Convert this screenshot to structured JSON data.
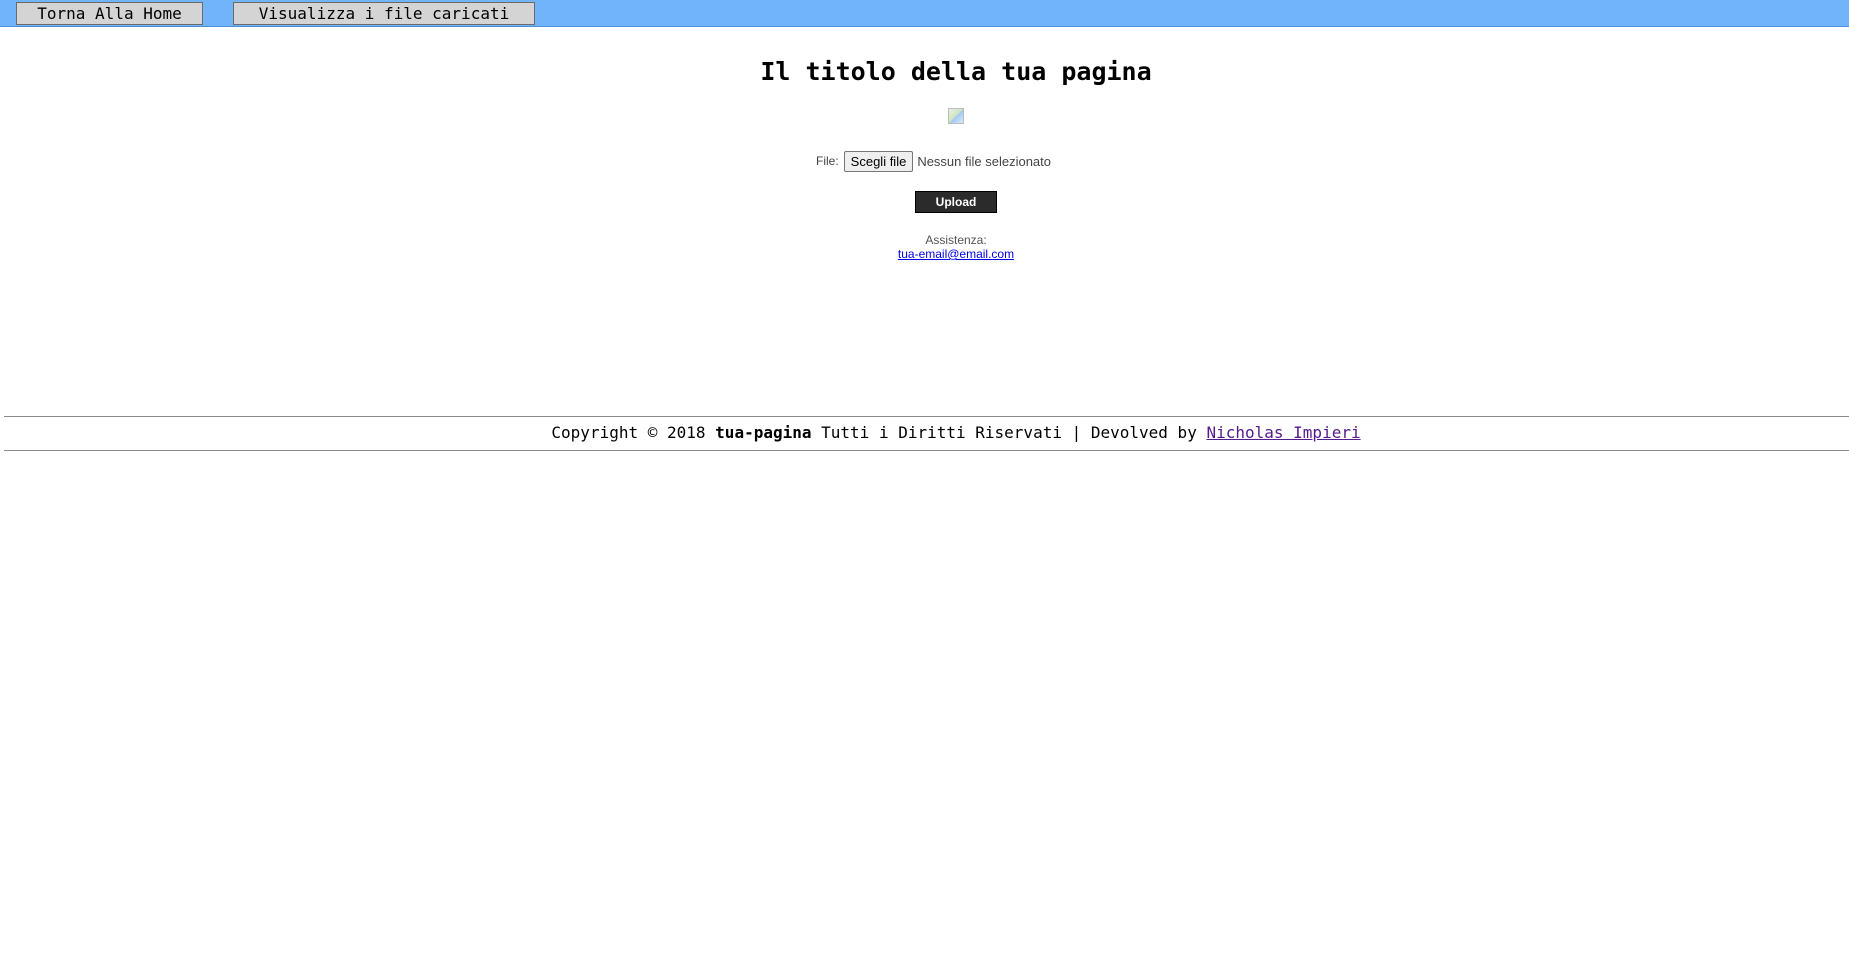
{
  "nav": {
    "home_label": "Torna Alla Home",
    "files_label": "Visualizza i file caricati"
  },
  "main": {
    "title": "Il titolo della tua pagina",
    "file_label": "File:",
    "choose_file_label": "Scegli file",
    "file_status": "Nessun file selezionato",
    "upload_label": "Upload",
    "support_label": "Assistenza:",
    "support_email": "tua-email@email.com"
  },
  "footer": {
    "copyright": "Copyright © 2018",
    "site_name": "tua-pagina",
    "rights": "Tutti i Diritti Riservati | Devolved by",
    "author": "Nicholas Impieri"
  },
  "colors": {
    "topbar": "#72b4fb",
    "upload_button": "#2b2b2b",
    "link": "#0000ee",
    "visited_link": "#551a8b"
  }
}
